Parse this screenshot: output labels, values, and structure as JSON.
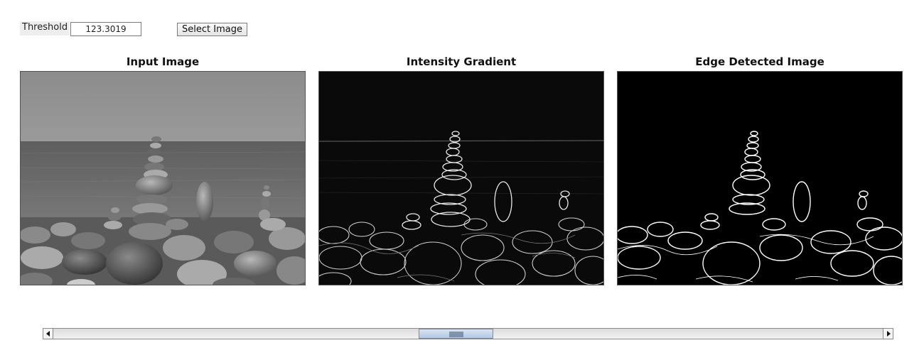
{
  "controls": {
    "threshold_label": "Threshold",
    "threshold_value": "123.3019",
    "select_button_label": "Select Image"
  },
  "panels": [
    {
      "title": "Input Image",
      "image_icon": "grayscale-photo-rock-cairns"
    },
    {
      "title": "Intensity Gradient",
      "image_icon": "gradient-magnitude-map"
    },
    {
      "title": "Edge Detected Image",
      "image_icon": "binary-edge-map"
    }
  ],
  "scrollbar": {
    "left_icon": "arrow-left-icon",
    "right_icon": "arrow-right-icon",
    "position_fraction": 0.49
  },
  "colors": {
    "panel_border": "#555555",
    "scroll_thumb": "#c4d4ea",
    "edge_white": "#ffffff",
    "background_black": "#000000"
  }
}
